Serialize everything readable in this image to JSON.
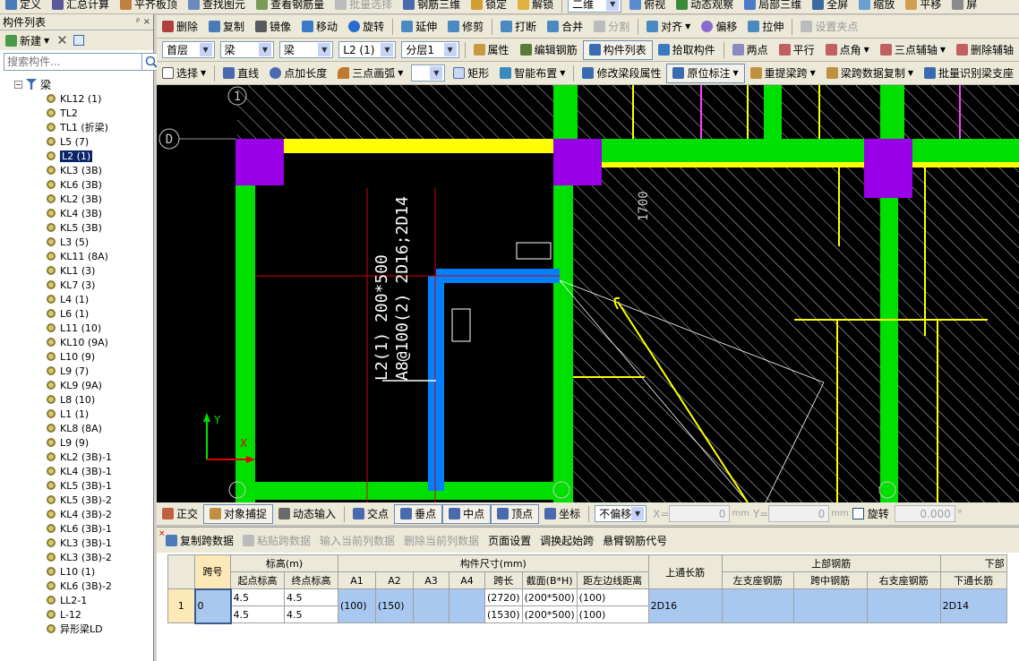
{
  "toolbar1": {
    "items": [
      "定义",
      "汇总计算",
      "平齐板顶",
      "查找图元",
      "查看钢筋量",
      "批量选择",
      "钢筋三维",
      "锁定",
      "解锁",
      "二维",
      "俯视",
      "动态观察",
      "局部三维",
      "全屏",
      "缩放",
      "平移",
      "屏"
    ]
  },
  "toolbar2": {
    "items": [
      "删除",
      "复制",
      "镜像",
      "移动",
      "旋转",
      "延伸",
      "修剪",
      "打断",
      "合并",
      "分割",
      "对齐",
      "偏移",
      "拉伸",
      "设置夹点"
    ]
  },
  "toolbar3": {
    "floor": "首层",
    "category": "梁",
    "type": "梁",
    "component": "L2 (1)",
    "layer": "分层1",
    "items": [
      "属性",
      "编辑钢筋",
      "构件列表",
      "拾取构件",
      "两点",
      "平行",
      "点角",
      "三点辅轴",
      "删除辅轴"
    ]
  },
  "toolbar4": {
    "items": [
      "选择",
      "直线",
      "点加长度",
      "三点画弧",
      "矩形",
      "智能布置",
      "修改梁段属性",
      "原位标注",
      "重提梁跨",
      "梁跨数据复制",
      "批量识别梁支座"
    ]
  },
  "left_panel": {
    "title": "构件列表",
    "pin": "ᵖ ×",
    "new_label": "新建",
    "search_placeholder": "搜索构件...",
    "root": "梁",
    "items": [
      "KL12 (1)",
      "TL2",
      "TL1 (折梁)",
      "L5 (7)",
      "L2 (1)",
      "KL3 (3B)",
      "KL6 (3B)",
      "KL2 (3B)",
      "KL4 (3B)",
      "KL5 (3B)",
      "L3 (5)",
      "KL11 (8A)",
      "KL1 (3)",
      "KL7 (3)",
      "L4 (1)",
      "L6 (1)",
      "L11 (10)",
      "KL10 (9A)",
      "L10 (9)",
      "L9 (7)",
      "KL9 (9A)",
      "L8 (10)",
      "L1 (1)",
      "KL8 (8A)",
      "L9 (9)",
      "KL2 (3B)-1",
      "KL4 (3B)-1",
      "KL5 (3B)-1",
      "KL5 (3B)-2",
      "KL4 (3B)-2",
      "KL6 (3B)-1",
      "KL3 (3B)-1",
      "KL3 (3B)-2",
      "L10 (1)",
      "KL6 (3B)-2",
      "LL2-1",
      "L-12",
      "异形梁LD"
    ],
    "selected_index": 4
  },
  "canvas": {
    "axis_d": "D",
    "axis_1": "1",
    "beam_label_1": "L2(1) 200*500",
    "beam_label_2": "A8@100(2) 2D16;2D14",
    "dim_label": "1700",
    "axis_y": "Y",
    "axis_x": "X",
    "colors": {
      "green": "#00e000",
      "yellow": "#ffff00",
      "purple": "#9a00e8",
      "blue": "#0080ff",
      "background": "#000000"
    }
  },
  "statusbar": {
    "items": [
      "正交",
      "对象捕捉",
      "动态输入",
      "交点",
      "垂点",
      "中点",
      "顶点",
      "坐标"
    ],
    "offset_mode": "不偏移",
    "x_label": "X=",
    "x_value": "0",
    "y_label": "Y=",
    "y_value": "0",
    "unit": "mm",
    "rotate_label": "旋转",
    "rotate_value": "0.000",
    "deg": "°"
  },
  "bottom_panel": {
    "toolbar": [
      "复制跨数据",
      "粘贴跨数据",
      "输入当前列数据",
      "删除当前列数据",
      "页面设置",
      "调换起始跨",
      "悬臂钢筋代号"
    ],
    "headers": {
      "span_no": "跨号",
      "elevation": "标高(m)",
      "start_elev": "起点标高",
      "end_elev": "终点标高",
      "dims": "构件尺寸(mm)",
      "a1": "A1",
      "a2": "A2",
      "a3": "A3",
      "a4": "A4",
      "span_len": "跨长",
      "section": "截面(B*H)",
      "edge_dist": "距左边线距离",
      "top_through": "上通长筋",
      "top_rebar": "上部钢筋",
      "left_support": "左支座钢筋",
      "mid_span": "跨中钢筋",
      "right_support": "右支座钢筋",
      "bottom_rebar": "下部",
      "bottom_through": "下通长筋"
    },
    "row": {
      "row_no": "1",
      "span": "0",
      "start_elev_1": "4.5",
      "end_elev_1": "4.5",
      "start_elev_2": "4.5",
      "end_elev_2": "4.5",
      "a1": "(100)",
      "a2": "(150)",
      "span_len_1": "(2720)",
      "section_1": "(200*500)",
      "edge_1": "(100)",
      "span_len_2": "(1530)",
      "section_2": "(200*500)",
      "edge_2": "(100)",
      "top_through": "2D16",
      "bottom_through": "2D14"
    }
  }
}
